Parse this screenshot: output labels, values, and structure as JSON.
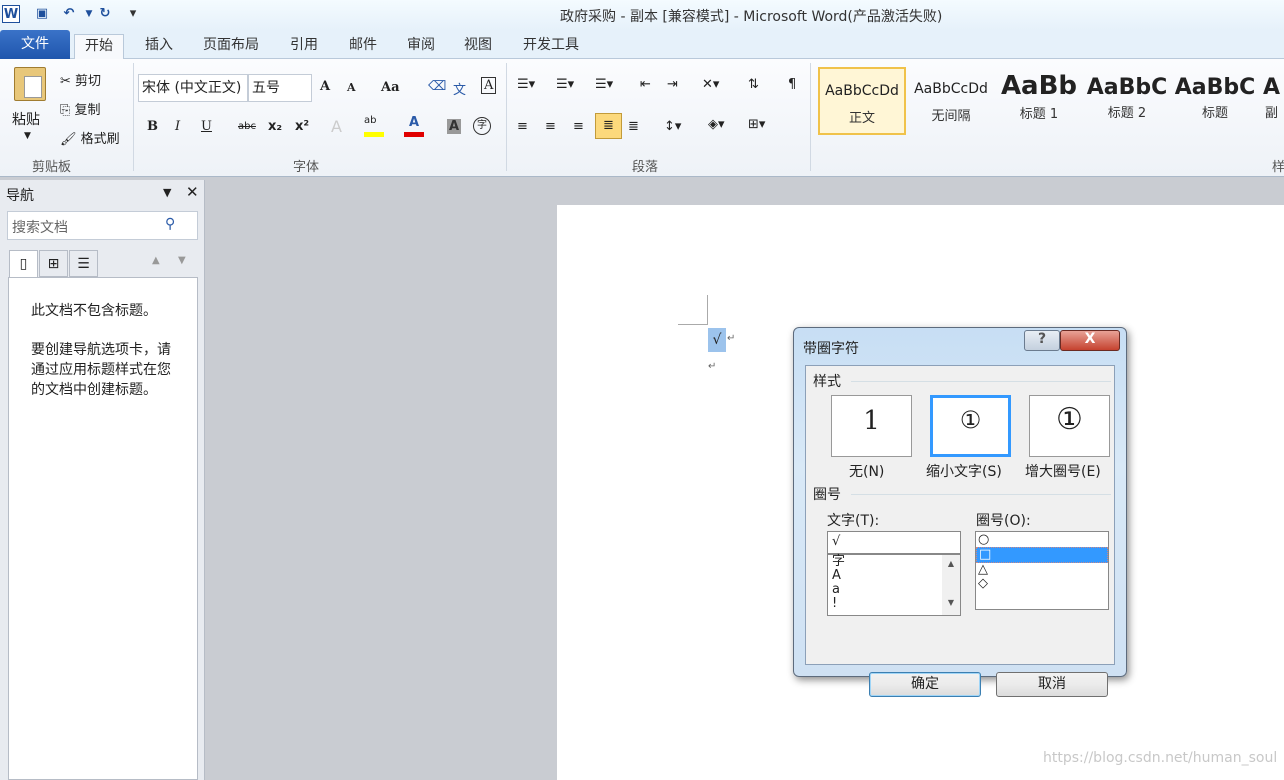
{
  "window": {
    "title": "政府采购 - 副本 [兼容模式] - Microsoft Word(产品激活失败)"
  },
  "quick_access": {
    "app_icon": "W",
    "save": "save-icon",
    "undo": "undo-icon",
    "redo": "redo-icon",
    "customize": "▾"
  },
  "tabs": [
    "文件",
    "开始",
    "插入",
    "页面布局",
    "引用",
    "邮件",
    "审阅",
    "视图",
    "开发工具"
  ],
  "ribbon": {
    "clipboard": {
      "paste": "粘贴",
      "cut": "剪切",
      "copy": "复制",
      "format_painter": "格式刷",
      "label": "剪贴板"
    },
    "font": {
      "font_name": "宋体 (中文正文)",
      "font_size": "五号",
      "label": "字体",
      "grow": "A",
      "shrink": "A",
      "case": "Aa",
      "bold": "B",
      "italic": "I",
      "underline": "U",
      "strike": "abc",
      "subscript": "x₂",
      "superscript": "x²",
      "font_color_hex": "#e00000",
      "highlight_hex": "#ffff00",
      "enclose": "字"
    },
    "paragraph": {
      "label": "段落"
    },
    "styles": {
      "items": [
        {
          "sample": "AaBbCcDd",
          "name": "正文"
        },
        {
          "sample": "AaBbCcDd",
          "name": "无间隔"
        },
        {
          "sample": "AaBb",
          "name": "标题 1"
        },
        {
          "sample": "AaBbC",
          "name": "标题 2"
        },
        {
          "sample": "AaBbC",
          "name": "标题"
        },
        {
          "sample": "A",
          "name": "副"
        }
      ],
      "label": "样"
    }
  },
  "nav": {
    "title": "导航",
    "search_placeholder": "搜索文档",
    "message1": "此文档不包含标题。",
    "message2": "要创建导航选项卡，请通过应用标题样式在您的文档中创建标题。"
  },
  "document": {
    "selected_text": "√",
    "para_mark": "↵"
  },
  "dialog": {
    "title": "带圈字符",
    "help": "?",
    "close": "X",
    "style_group": "样式",
    "styles": [
      {
        "preview": "1",
        "label": "无(N)"
      },
      {
        "preview": "①",
        "label": "缩小文字(S)"
      },
      {
        "preview": "①",
        "label": "增大圈号(E)"
      }
    ],
    "enclosure_group": "圈号",
    "text_label": "文字(T):",
    "text_value": "√",
    "text_items": [
      "字",
      "A",
      "a",
      "!"
    ],
    "enclosure_label": "圈号(O):",
    "enclosure_items": [
      "○",
      "□",
      "△",
      "◇"
    ],
    "enclosure_selected": "□",
    "ok": "确定",
    "cancel": "取消"
  },
  "watermark": "https://blog.csdn.net/human_soul"
}
